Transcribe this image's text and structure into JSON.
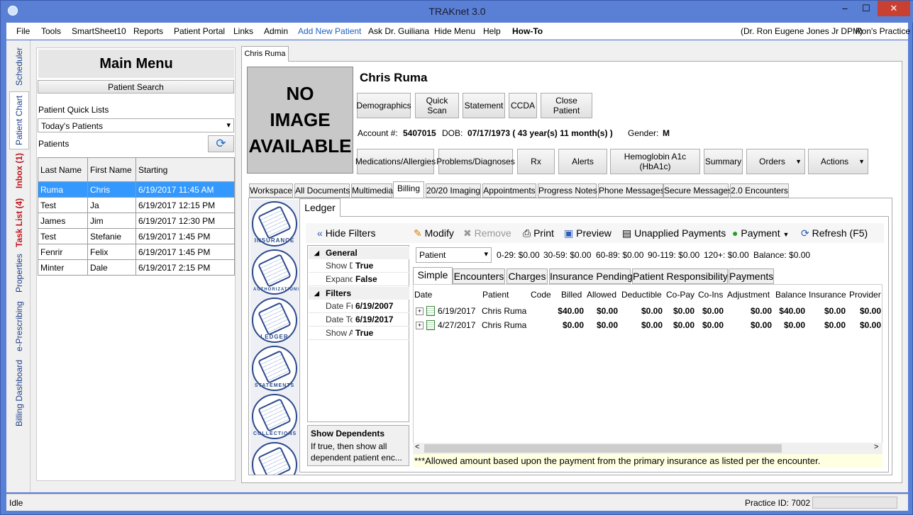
{
  "window": {
    "title": "TRAKnet 3.0",
    "min": "‒",
    "max": "☐",
    "close": "✕"
  },
  "menu": {
    "items": [
      "File",
      "Tools",
      "SmartSheet10",
      "Reports",
      "Patient Portal",
      "Links",
      "Admin",
      "Add New Patient",
      "Ask Dr. Guiliana",
      "Hide Menu",
      "Help",
      "How-To"
    ],
    "user": "(Dr. Ron Eugene Jones Jr DPM)",
    "practice": "Ron's Practice",
    "link_color": "#1f5fbf"
  },
  "side_tabs": [
    "Scheduler",
    "Patient Chart",
    "Inbox (1)",
    "Task List (4)",
    "Properties",
    "e-Prescribing",
    "Billing Dashboard"
  ],
  "left": {
    "title": "Main Menu",
    "search_btn": "Patient Search",
    "quick_label": "Patient Quick Lists",
    "quick_value": "Today's Patients",
    "patients_label": "Patients",
    "columns": [
      "Last Name",
      "First Name",
      "Starting"
    ],
    "rows": [
      [
        "Ruma",
        "Chris",
        "6/19/2017 11:45 AM"
      ],
      [
        "Test",
        "Ja",
        "6/19/2017 12:15 PM"
      ],
      [
        "James",
        "Jim",
        "6/19/2017 12:30 PM"
      ],
      [
        "Test",
        "Stefanie",
        "6/19/2017 1:45 PM"
      ],
      [
        "Fenrir",
        "Felix",
        "6/19/2017 1:45 PM"
      ],
      [
        "Minter",
        "Dale",
        "6/19/2017 2:15 PM"
      ]
    ]
  },
  "doc_tab": "Chris Ruma",
  "patient": {
    "photo_lines": [
      "NO",
      "IMAGE",
      "AVAILABLE"
    ],
    "name": "Chris Ruma",
    "buttons1": [
      "Demographics",
      "Quick Scan",
      "Statement",
      "CCDA",
      "Close Patient"
    ],
    "account_label": "Account #:",
    "account": "5407015",
    "dob_label": "DOB:",
    "dob": "07/17/1973 ( 43 year(s) 11 month(s) )",
    "gender_label": "Gender:",
    "gender": "M",
    "buttons2": [
      "Medications/Allergies",
      "Problems/Diagnoses",
      "Rx",
      "Alerts",
      "Hemoglobin A1c (HbA1c)",
      "Summary",
      "Orders",
      "Actions"
    ]
  },
  "chart_tabs": [
    "Workspace",
    "All Documents",
    "Multimedia",
    "Billing",
    "20/20 Imaging",
    "Appointments",
    "Progress Notes",
    "Phone Messages",
    "Secure Messages",
    "2.0 Encounters"
  ],
  "billing_icons": [
    "INSURANCE",
    "AUTHORIZATIONS",
    "LEDGER",
    "STATEMENTS",
    "COLLECTIONS"
  ],
  "ledger": {
    "tab": "Ledger",
    "toolbar": {
      "hide_filters": "Hide Filters",
      "modify": "Modify",
      "remove": "Remove",
      "print": "Print",
      "preview": "Preview",
      "unapplied": "Unapplied Payments",
      "payment": "Payment",
      "refresh": "Refresh (F5)"
    },
    "filters": {
      "general": "General",
      "rows_general": [
        [
          "Show D",
          "True"
        ],
        [
          "Expanc",
          "False"
        ]
      ],
      "filters": "Filters",
      "rows_filters": [
        [
          "Date Fr",
          "6/19/2007"
        ],
        [
          "Date To",
          "6/19/2017"
        ],
        [
          "Show A",
          "True"
        ]
      ]
    },
    "desc_title": "Show Dependents",
    "desc_text": "If true, then show all dependent  patient enc...",
    "patient_select": "Patient",
    "aging": [
      "0-29: $0.00",
      "30-59: $0.00",
      "60-89: $0.00",
      "90-119: $0.00",
      "120+: $0.00",
      "Balance: $0.00"
    ],
    "subtabs": [
      "Simple",
      "Encounters",
      "Charges",
      "Insurance Pending",
      "Patient Responsibility",
      "Payments"
    ],
    "columns": [
      "Date",
      "Patient",
      "Code",
      "Billed",
      "Allowed",
      "Deductible",
      "Co-Pay",
      "Co-Ins",
      "Adjustment",
      "Balance",
      "Insurance",
      "Provider"
    ],
    "rows": [
      {
        "date": "6/19/2017",
        "patient": "Chris Ruma",
        "billed": "$40.00",
        "allowed": "$0.00",
        "deductible": "$0.00",
        "copay": "$0.00",
        "coins": "$0.00",
        "adjustment": "$0.00",
        "balance": "$40.00",
        "insurance": "$0.00",
        "provider": "$0.00"
      },
      {
        "date": "4/27/2017",
        "patient": "Chris Ruma",
        "billed": "$0.00",
        "allowed": "$0.00",
        "deductible": "$0.00",
        "copay": "$0.00",
        "coins": "$0.00",
        "adjustment": "$0.00",
        "balance": "$0.00",
        "insurance": "$0.00",
        "provider": "$0.00"
      }
    ],
    "note": "***Allowed amount based upon the payment from the primary insurance as listed per the encounter."
  },
  "status": {
    "left": "Idle",
    "practice_id": "Practice ID: 7002"
  }
}
